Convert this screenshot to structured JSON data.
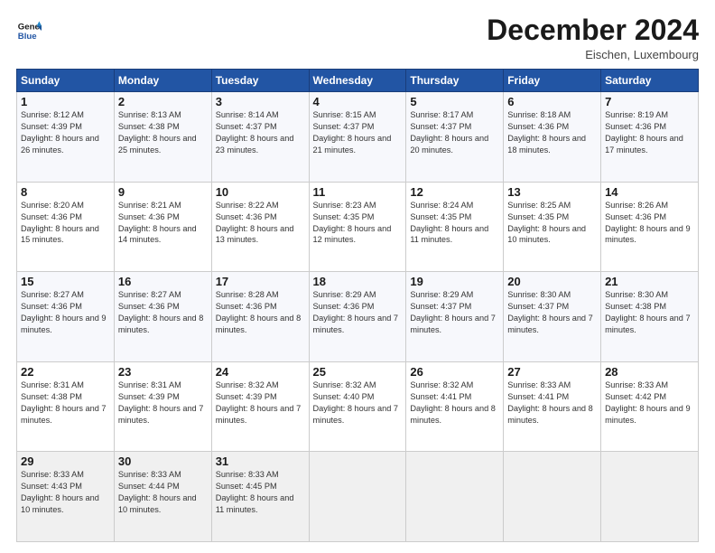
{
  "logo": {
    "line1": "General",
    "line2": "Blue"
  },
  "title": "December 2024",
  "location": "Eischen, Luxembourg",
  "weekdays": [
    "Sunday",
    "Monday",
    "Tuesday",
    "Wednesday",
    "Thursday",
    "Friday",
    "Saturday"
  ],
  "weeks": [
    [
      {
        "day": "1",
        "sunrise": "Sunrise: 8:12 AM",
        "sunset": "Sunset: 4:39 PM",
        "daylight": "Daylight: 8 hours and 26 minutes."
      },
      {
        "day": "2",
        "sunrise": "Sunrise: 8:13 AM",
        "sunset": "Sunset: 4:38 PM",
        "daylight": "Daylight: 8 hours and 25 minutes."
      },
      {
        "day": "3",
        "sunrise": "Sunrise: 8:14 AM",
        "sunset": "Sunset: 4:37 PM",
        "daylight": "Daylight: 8 hours and 23 minutes."
      },
      {
        "day": "4",
        "sunrise": "Sunrise: 8:15 AM",
        "sunset": "Sunset: 4:37 PM",
        "daylight": "Daylight: 8 hours and 21 minutes."
      },
      {
        "day": "5",
        "sunrise": "Sunrise: 8:17 AM",
        "sunset": "Sunset: 4:37 PM",
        "daylight": "Daylight: 8 hours and 20 minutes."
      },
      {
        "day": "6",
        "sunrise": "Sunrise: 8:18 AM",
        "sunset": "Sunset: 4:36 PM",
        "daylight": "Daylight: 8 hours and 18 minutes."
      },
      {
        "day": "7",
        "sunrise": "Sunrise: 8:19 AM",
        "sunset": "Sunset: 4:36 PM",
        "daylight": "Daylight: 8 hours and 17 minutes."
      }
    ],
    [
      {
        "day": "8",
        "sunrise": "Sunrise: 8:20 AM",
        "sunset": "Sunset: 4:36 PM",
        "daylight": "Daylight: 8 hours and 15 minutes."
      },
      {
        "day": "9",
        "sunrise": "Sunrise: 8:21 AM",
        "sunset": "Sunset: 4:36 PM",
        "daylight": "Daylight: 8 hours and 14 minutes."
      },
      {
        "day": "10",
        "sunrise": "Sunrise: 8:22 AM",
        "sunset": "Sunset: 4:36 PM",
        "daylight": "Daylight: 8 hours and 13 minutes."
      },
      {
        "day": "11",
        "sunrise": "Sunrise: 8:23 AM",
        "sunset": "Sunset: 4:35 PM",
        "daylight": "Daylight: 8 hours and 12 minutes."
      },
      {
        "day": "12",
        "sunrise": "Sunrise: 8:24 AM",
        "sunset": "Sunset: 4:35 PM",
        "daylight": "Daylight: 8 hours and 11 minutes."
      },
      {
        "day": "13",
        "sunrise": "Sunrise: 8:25 AM",
        "sunset": "Sunset: 4:35 PM",
        "daylight": "Daylight: 8 hours and 10 minutes."
      },
      {
        "day": "14",
        "sunrise": "Sunrise: 8:26 AM",
        "sunset": "Sunset: 4:36 PM",
        "daylight": "Daylight: 8 hours and 9 minutes."
      }
    ],
    [
      {
        "day": "15",
        "sunrise": "Sunrise: 8:27 AM",
        "sunset": "Sunset: 4:36 PM",
        "daylight": "Daylight: 8 hours and 9 minutes."
      },
      {
        "day": "16",
        "sunrise": "Sunrise: 8:27 AM",
        "sunset": "Sunset: 4:36 PM",
        "daylight": "Daylight: 8 hours and 8 minutes."
      },
      {
        "day": "17",
        "sunrise": "Sunrise: 8:28 AM",
        "sunset": "Sunset: 4:36 PM",
        "daylight": "Daylight: 8 hours and 8 minutes."
      },
      {
        "day": "18",
        "sunrise": "Sunrise: 8:29 AM",
        "sunset": "Sunset: 4:36 PM",
        "daylight": "Daylight: 8 hours and 7 minutes."
      },
      {
        "day": "19",
        "sunrise": "Sunrise: 8:29 AM",
        "sunset": "Sunset: 4:37 PM",
        "daylight": "Daylight: 8 hours and 7 minutes."
      },
      {
        "day": "20",
        "sunrise": "Sunrise: 8:30 AM",
        "sunset": "Sunset: 4:37 PM",
        "daylight": "Daylight: 8 hours and 7 minutes."
      },
      {
        "day": "21",
        "sunrise": "Sunrise: 8:30 AM",
        "sunset": "Sunset: 4:38 PM",
        "daylight": "Daylight: 8 hours and 7 minutes."
      }
    ],
    [
      {
        "day": "22",
        "sunrise": "Sunrise: 8:31 AM",
        "sunset": "Sunset: 4:38 PM",
        "daylight": "Daylight: 8 hours and 7 minutes."
      },
      {
        "day": "23",
        "sunrise": "Sunrise: 8:31 AM",
        "sunset": "Sunset: 4:39 PM",
        "daylight": "Daylight: 8 hours and 7 minutes."
      },
      {
        "day": "24",
        "sunrise": "Sunrise: 8:32 AM",
        "sunset": "Sunset: 4:39 PM",
        "daylight": "Daylight: 8 hours and 7 minutes."
      },
      {
        "day": "25",
        "sunrise": "Sunrise: 8:32 AM",
        "sunset": "Sunset: 4:40 PM",
        "daylight": "Daylight: 8 hours and 7 minutes."
      },
      {
        "day": "26",
        "sunrise": "Sunrise: 8:32 AM",
        "sunset": "Sunset: 4:41 PM",
        "daylight": "Daylight: 8 hours and 8 minutes."
      },
      {
        "day": "27",
        "sunrise": "Sunrise: 8:33 AM",
        "sunset": "Sunset: 4:41 PM",
        "daylight": "Daylight: 8 hours and 8 minutes."
      },
      {
        "day": "28",
        "sunrise": "Sunrise: 8:33 AM",
        "sunset": "Sunset: 4:42 PM",
        "daylight": "Daylight: 8 hours and 9 minutes."
      }
    ],
    [
      {
        "day": "29",
        "sunrise": "Sunrise: 8:33 AM",
        "sunset": "Sunset: 4:43 PM",
        "daylight": "Daylight: 8 hours and 10 minutes."
      },
      {
        "day": "30",
        "sunrise": "Sunrise: 8:33 AM",
        "sunset": "Sunset: 4:44 PM",
        "daylight": "Daylight: 8 hours and 10 minutes."
      },
      {
        "day": "31",
        "sunrise": "Sunrise: 8:33 AM",
        "sunset": "Sunset: 4:45 PM",
        "daylight": "Daylight: 8 hours and 11 minutes."
      },
      null,
      null,
      null,
      null
    ]
  ]
}
